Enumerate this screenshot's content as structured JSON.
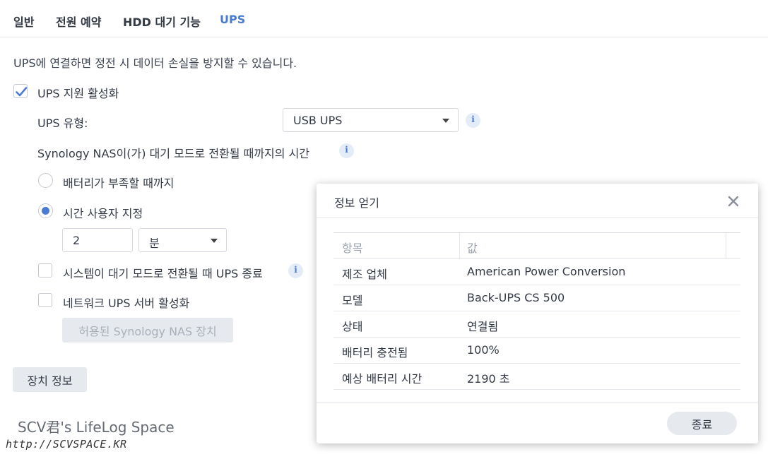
{
  "tabs": [
    {
      "label": "일반"
    },
    {
      "label": "전원 예약"
    },
    {
      "label": "HDD 대기 기능"
    },
    {
      "label": "UPS"
    }
  ],
  "active_tab": "UPS",
  "description": "UPS에 연결하면 정전 시 데이터 손실을 방지할 수 있습니다.",
  "ups_enable": {
    "label": "UPS 지원 활성화",
    "checked": true
  },
  "ups_type": {
    "label": "UPS 유형:",
    "value": "USB UPS"
  },
  "standby_time": {
    "label": "Synology NAS이(가) 대기 모드로 전환될 때까지의 시간"
  },
  "radio_battery_low": {
    "label": "배터리가 부족할 때까지",
    "selected": false
  },
  "radio_custom": {
    "label": "시간 사용자 지정",
    "selected": true
  },
  "custom_time": {
    "value": "2",
    "unit": "분"
  },
  "shutdown_ups": {
    "label": "시스템이 대기 모드로 전환될 때 UPS 종료",
    "checked": false
  },
  "network_ups": {
    "label": "네트워크 UPS 서버 활성화",
    "checked": false
  },
  "allowed_devices_button": "허용된 Synology NAS 장치",
  "device_info_button": "장치 정보",
  "watermark": {
    "line1": "SCV君's LifeLog Space",
    "line2": "http://SCVSPACE.KR"
  },
  "modal": {
    "title": "정보 얻기",
    "table": {
      "headers": [
        "항목",
        "값"
      ],
      "rows": [
        [
          "제조 업체",
          "American Power Conversion"
        ],
        [
          "모델",
          "Back-UPS CS 500"
        ],
        [
          "상태",
          "연결됨"
        ],
        [
          "배터리 충전됨",
          "100%"
        ],
        [
          "예상 배터리 시간",
          "2190 초"
        ]
      ]
    },
    "close_button": "종료"
  },
  "colors": {
    "accent": "#4a7bd3",
    "button_bg": "#e6e9ee",
    "border": "#d5d9df"
  }
}
